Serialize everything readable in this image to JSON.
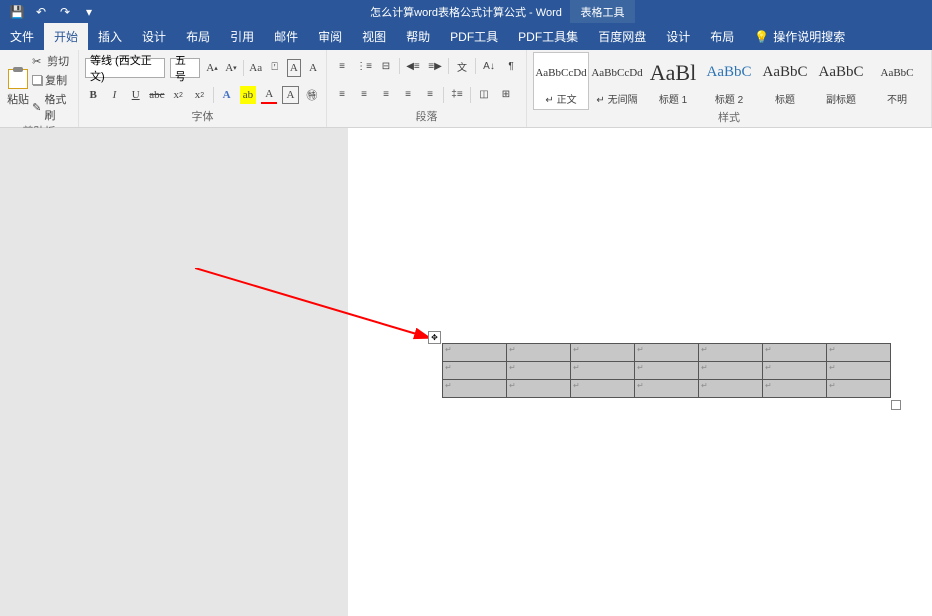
{
  "title": "怎么计算word表格公式计算公式 - Word",
  "context_tab": "表格工具",
  "menu": {
    "file": "文件",
    "home": "开始",
    "insert": "插入",
    "design": "设计",
    "layout": "布局",
    "references": "引用",
    "mailings": "邮件",
    "review": "审阅",
    "view": "视图",
    "help": "帮助",
    "pdf_tool": "PDF工具",
    "pdf_suite": "PDF工具集",
    "baidu": "百度网盘",
    "table_design": "设计",
    "table_layout": "布局",
    "tell_me": "操作说明搜索"
  },
  "clipboard": {
    "paste": "粘贴",
    "cut": "剪切",
    "copy": "复制",
    "format_painter": "格式刷",
    "group_label": "剪贴板"
  },
  "font": {
    "name": "等线 (西文正文)",
    "size": "五号",
    "group_label": "字体"
  },
  "paragraph": {
    "group_label": "段落"
  },
  "styles": {
    "group_label": "样式",
    "items": [
      {
        "preview": "AaBbCcDd",
        "name": "↵ 正文",
        "cls": ""
      },
      {
        "preview": "AaBbCcDd",
        "name": "↵ 无间隔",
        "cls": ""
      },
      {
        "preview": "AaBl",
        "name": "标题 1",
        "cls": "big"
      },
      {
        "preview": "AaBbC",
        "name": "标题 2",
        "cls": "med"
      },
      {
        "preview": "AaBbC",
        "name": "标题",
        "cls": "med2"
      },
      {
        "preview": "AaBbC",
        "name": "副标题",
        "cls": "med2"
      },
      {
        "preview": "AaBbC",
        "name": "不明",
        "cls": ""
      }
    ]
  },
  "table": {
    "rows": 3,
    "cols": 7,
    "cell_content": ""
  }
}
